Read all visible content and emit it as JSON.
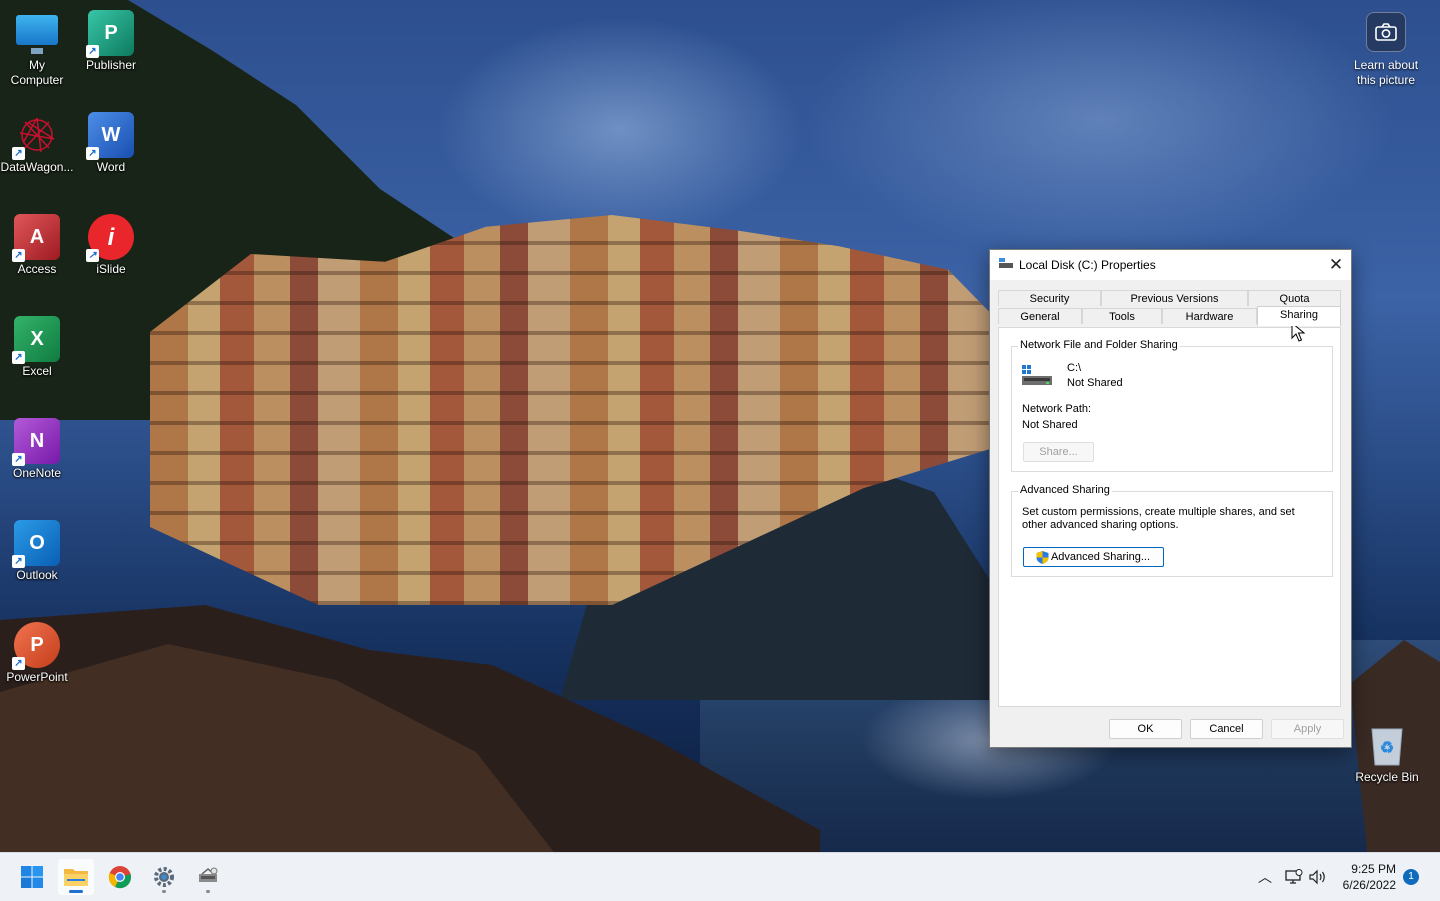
{
  "desktop": {
    "icons": [
      {
        "label": "My\nComputer"
      },
      {
        "label": "Publisher"
      },
      {
        "label": "DataWagon..."
      },
      {
        "label": "Word"
      },
      {
        "label": "Access"
      },
      {
        "label": "iSlide"
      },
      {
        "label": "Excel"
      },
      {
        "label": "OneNote"
      },
      {
        "label": "Outlook"
      },
      {
        "label": "PowerPoint"
      },
      {
        "label": "Recycle Bin"
      }
    ],
    "learn_label": "Learn about this picture"
  },
  "dialog": {
    "title": "Local Disk (C:) Properties",
    "close_glyph": "✕",
    "tabs_row1": [
      "Security",
      "Previous Versions",
      "Quota"
    ],
    "tabs_row2": [
      "General",
      "Tools",
      "Hardware",
      "Sharing"
    ],
    "active_tab": "Sharing",
    "network_group": {
      "label": "Network File and Folder Sharing",
      "drive_name": "C:\\",
      "drive_status": "Not Shared",
      "path_label": "Network Path:",
      "path_value": "Not Shared",
      "share_button": "Share..."
    },
    "advanced_group": {
      "label": "Advanced Sharing",
      "description": "Set custom permissions, create multiple shares, and set other advanced sharing options.",
      "button": "Advanced Sharing..."
    },
    "buttons": {
      "ok": "OK",
      "cancel": "Cancel",
      "apply": "Apply"
    }
  },
  "taskbar": {
    "items": [
      "start-icon",
      "file-explorer-icon",
      "chrome-icon",
      "settings-icon",
      "network-tool-icon"
    ],
    "clock_time": "9:25 PM",
    "clock_date": "6/26/2022",
    "notification_count": "1",
    "accent": "#1e6fd0"
  }
}
